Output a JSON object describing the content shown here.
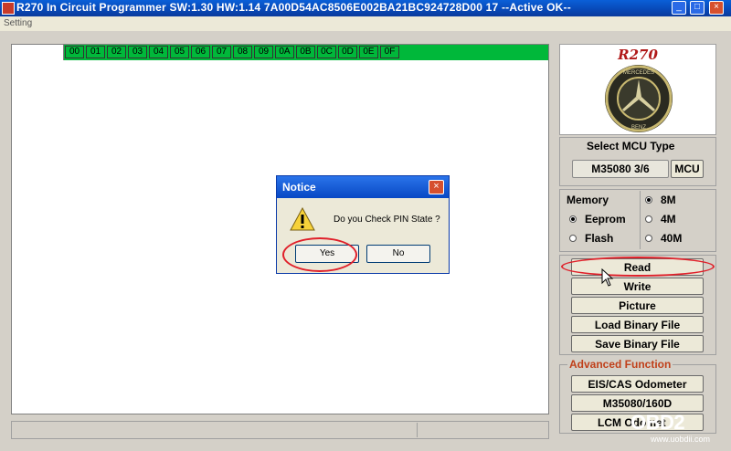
{
  "window": {
    "title": "R270 In Circuit Programmer SW:1.30 HW:1.14 7A00D54AC8506E002BA21BC924728D00 17 --Active OK--",
    "menu": [
      "Setting"
    ]
  },
  "hex_header": [
    "00",
    "01",
    "02",
    "03",
    "04",
    "05",
    "06",
    "07",
    "08",
    "09",
    "0A",
    "0B",
    "0C",
    "0D",
    "0E",
    "0F"
  ],
  "logo": {
    "text": "R270",
    "badge_top": "MERCEDES",
    "badge_bottom": "BENZ"
  },
  "mcu": {
    "label": "Select MCU Type",
    "value": "M35080 3/6",
    "button": "MCU"
  },
  "memory": {
    "label": "Memory",
    "options": [
      {
        "label": "Eeprom",
        "selected": true
      },
      {
        "label": "Flash",
        "selected": false
      }
    ],
    "sizes": [
      {
        "label": "8M",
        "selected": true
      },
      {
        "label": "4M",
        "selected": false
      },
      {
        "label": "40M",
        "selected": false
      }
    ]
  },
  "actions": [
    "Read",
    "Write",
    "Picture",
    "Load Binary File",
    "Save Binary File"
  ],
  "advanced": {
    "label": "Advanced Function",
    "buttons": [
      "EIS/CAS Odometer",
      "M35080/160D",
      "LCM Odomet"
    ]
  },
  "dialog": {
    "title": "Notice",
    "message": "Do you Check PIN State ?",
    "yes": "Yes",
    "no": "No"
  },
  "watermark": {
    "text": "OBD2",
    "url": "www.uobdii.com"
  },
  "colors": {
    "hex_header": "#00b83a",
    "highlight": "#e0202a",
    "advanced_label": "#c0401a"
  }
}
